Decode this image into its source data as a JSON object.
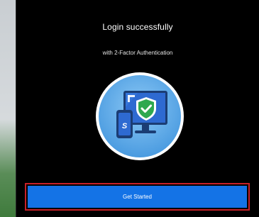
{
  "dialog": {
    "title": "Login successfully",
    "subtitle": "with 2-Factor Authentication",
    "illustration": {
      "icons": [
        "monitor-icon",
        "phone-icon",
        "shield-check-icon"
      ]
    },
    "primary_button": {
      "label": "Get Started",
      "highlighted": true
    }
  },
  "colors": {
    "dialog_bg": "#000000",
    "button_blue": "#1473e6",
    "highlight_red": "#c62027",
    "illustration_circle": "#5aa9ea",
    "shield_green": "#2fa84f"
  }
}
